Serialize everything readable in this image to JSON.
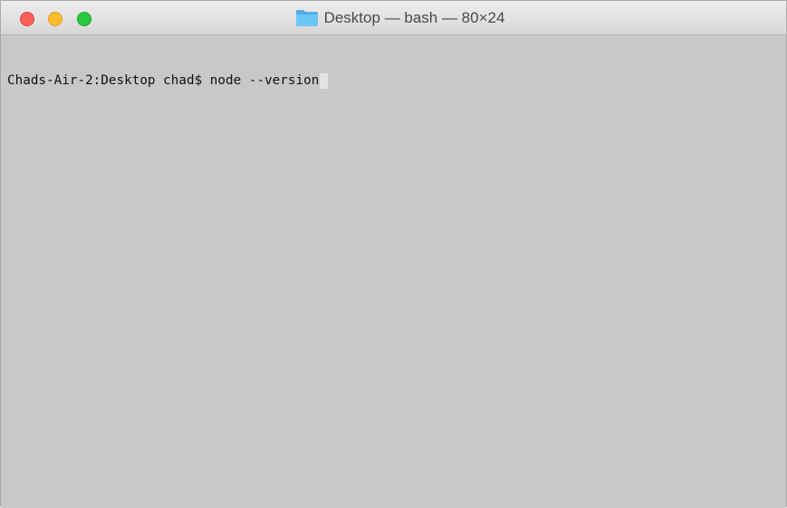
{
  "window": {
    "title": "Desktop — bash — 80×24",
    "folder_icon": "folder-icon",
    "colors": {
      "close": "#fb5f57",
      "minimize": "#fdbc2e",
      "zoom": "#28c840",
      "terminal_bg": "#c8c8c8",
      "folder": "#59b9f0"
    }
  },
  "terminal": {
    "prompt": "Chads-Air-2:Desktop chad$ ",
    "command": "node --version"
  }
}
